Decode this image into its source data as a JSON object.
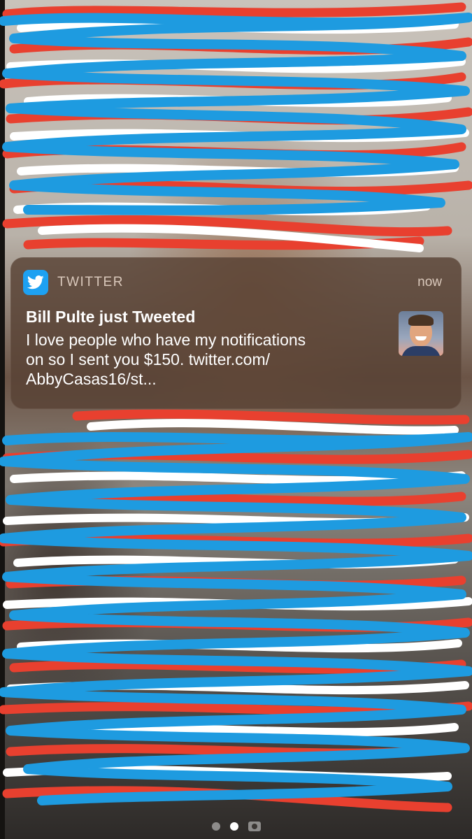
{
  "notification": {
    "app_name": "TWITTER",
    "time": "now",
    "title": "Bill Pulte just Tweeted",
    "body": "I love people who have my notifications\non so I sent you $150. twitter.com/\nAbbyCasas16/st..."
  },
  "icons": {
    "app_icon": "twitter-bird-icon",
    "avatar": "profile-photo",
    "page_indicator": [
      "page-dot",
      "page-dot-active",
      "camera-icon"
    ]
  },
  "colors": {
    "twitter_blue": "#1da1f2",
    "scribble_red": "#e8402f",
    "scribble_blue": "#1e9be0",
    "scribble_white": "#ffffff"
  }
}
